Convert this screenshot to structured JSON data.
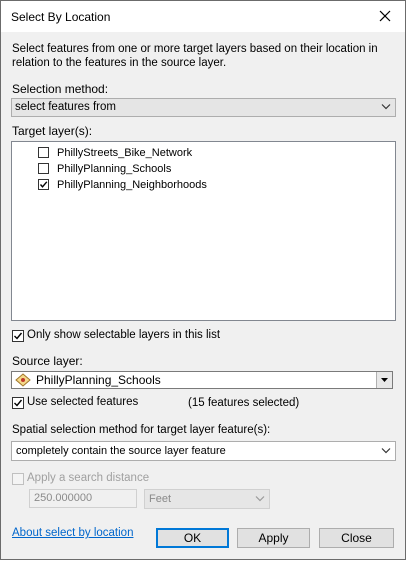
{
  "window": {
    "title": "Select By Location"
  },
  "description": "Select features from one or more target layers based on their location in relation to the features in the source layer.",
  "selection_method": {
    "label": "Selection method:",
    "value": "select features from"
  },
  "target_layers": {
    "label": "Target layer(s):",
    "items": [
      {
        "label": "PhillyStreets_Bike_Network",
        "checked": false
      },
      {
        "label": "PhillyPlanning_Schools",
        "checked": false
      },
      {
        "label": "PhillyPlanning_Neighborhoods",
        "checked": true
      }
    ]
  },
  "only_selectable": {
    "label": "Only show selectable layers in this list",
    "checked": true
  },
  "source_layer": {
    "label": "Source layer:",
    "value": "PhillyPlanning_Schools",
    "icon": "point-layer-icon"
  },
  "use_selected": {
    "label": "Use selected features",
    "checked": true,
    "count_text": "(15 features selected)"
  },
  "spatial_method": {
    "label": "Spatial selection method for target layer feature(s):",
    "value": "completely contain the source layer feature"
  },
  "search_distance": {
    "label": "Apply a search distance",
    "checked": false,
    "value": "250.000000",
    "unit": "Feet"
  },
  "footer": {
    "help_link": "About select by location",
    "ok": "OK",
    "apply": "Apply",
    "close": "Close"
  },
  "colors": {
    "link": "#0066cc",
    "default_button_border": "#0078d7",
    "dialog_bg": "#f0f0f0"
  }
}
